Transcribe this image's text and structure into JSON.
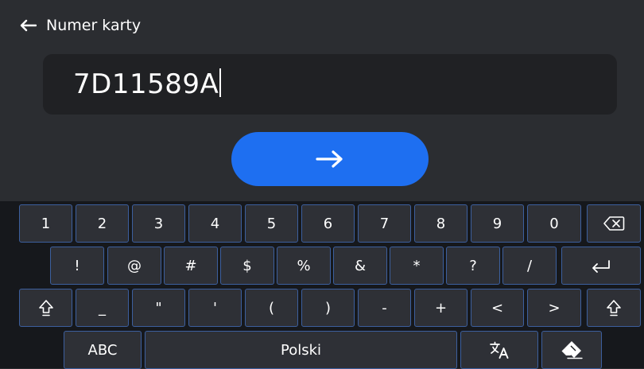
{
  "header": {
    "title": "Numer karty",
    "back_icon": "arrow-left-icon"
  },
  "input": {
    "value": "7D11589A"
  },
  "confirm_button": {
    "icon": "arrow-right-icon",
    "color": "#1e6ff1"
  },
  "keyboard": {
    "row1": [
      "1",
      "2",
      "3",
      "4",
      "5",
      "6",
      "7",
      "8",
      "9",
      "0"
    ],
    "row1_backspace_icon": "backspace-icon",
    "row2": [
      "!",
      "@",
      "#",
      "$",
      "%",
      "&",
      "*",
      "?",
      "/"
    ],
    "row2_enter_icon": "enter-icon",
    "row3_shift_icon": "shift-icon",
    "row3": [
      "_",
      "\"",
      "'",
      "(",
      ")",
      "-",
      "+",
      "<",
      ">"
    ],
    "row4": {
      "abc": "ABC",
      "space": "Polski",
      "translate_icon": "translate-icon",
      "eraser_icon": "eraser-icon"
    }
  },
  "colors": {
    "background": "#2b2d31",
    "keyboard_bg": "#16181c",
    "key_bg": "#2e3036",
    "key_border": "#3c5f9e",
    "input_bg": "#202124"
  }
}
